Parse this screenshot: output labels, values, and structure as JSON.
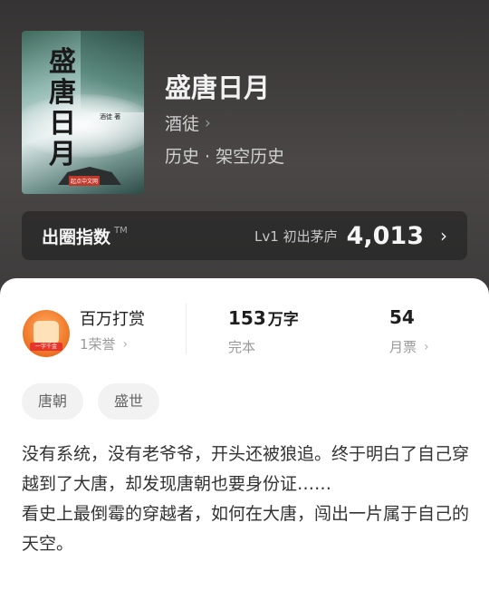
{
  "book": {
    "cover": {
      "title_text": "盛唐日月",
      "author_text": "酒徒 著",
      "brand_text": "起点中文网"
    },
    "title": "盛唐日月",
    "author": "酒徒",
    "genre": "历史 · 架空历史"
  },
  "index": {
    "label": "出圈指数",
    "tm": "TM",
    "level": "Lv1 初出茅庐",
    "score": "4,013"
  },
  "stats": {
    "reward_title": "百万打赏",
    "reward_sub": "1荣誉",
    "badge_text": "一字千金",
    "words_value": "153",
    "words_unit": "万字",
    "words_sub": "完本",
    "tickets_value": "54",
    "tickets_sub": "月票"
  },
  "tags": [
    "唐朝",
    "盛世"
  ],
  "description": "没有系统，没有老爷爷，开头还被狼追。终于明白了自己穿越到了大唐，却发现唐朝也要身份证……\n看史上最倒霉的穿越者，如何在大唐，闯出一片属于自己的天空。",
  "icons": {
    "author_chevron": "chevron-right-icon",
    "index_chevron": "chevron-right-icon",
    "badge": "reward-badge-icon"
  }
}
